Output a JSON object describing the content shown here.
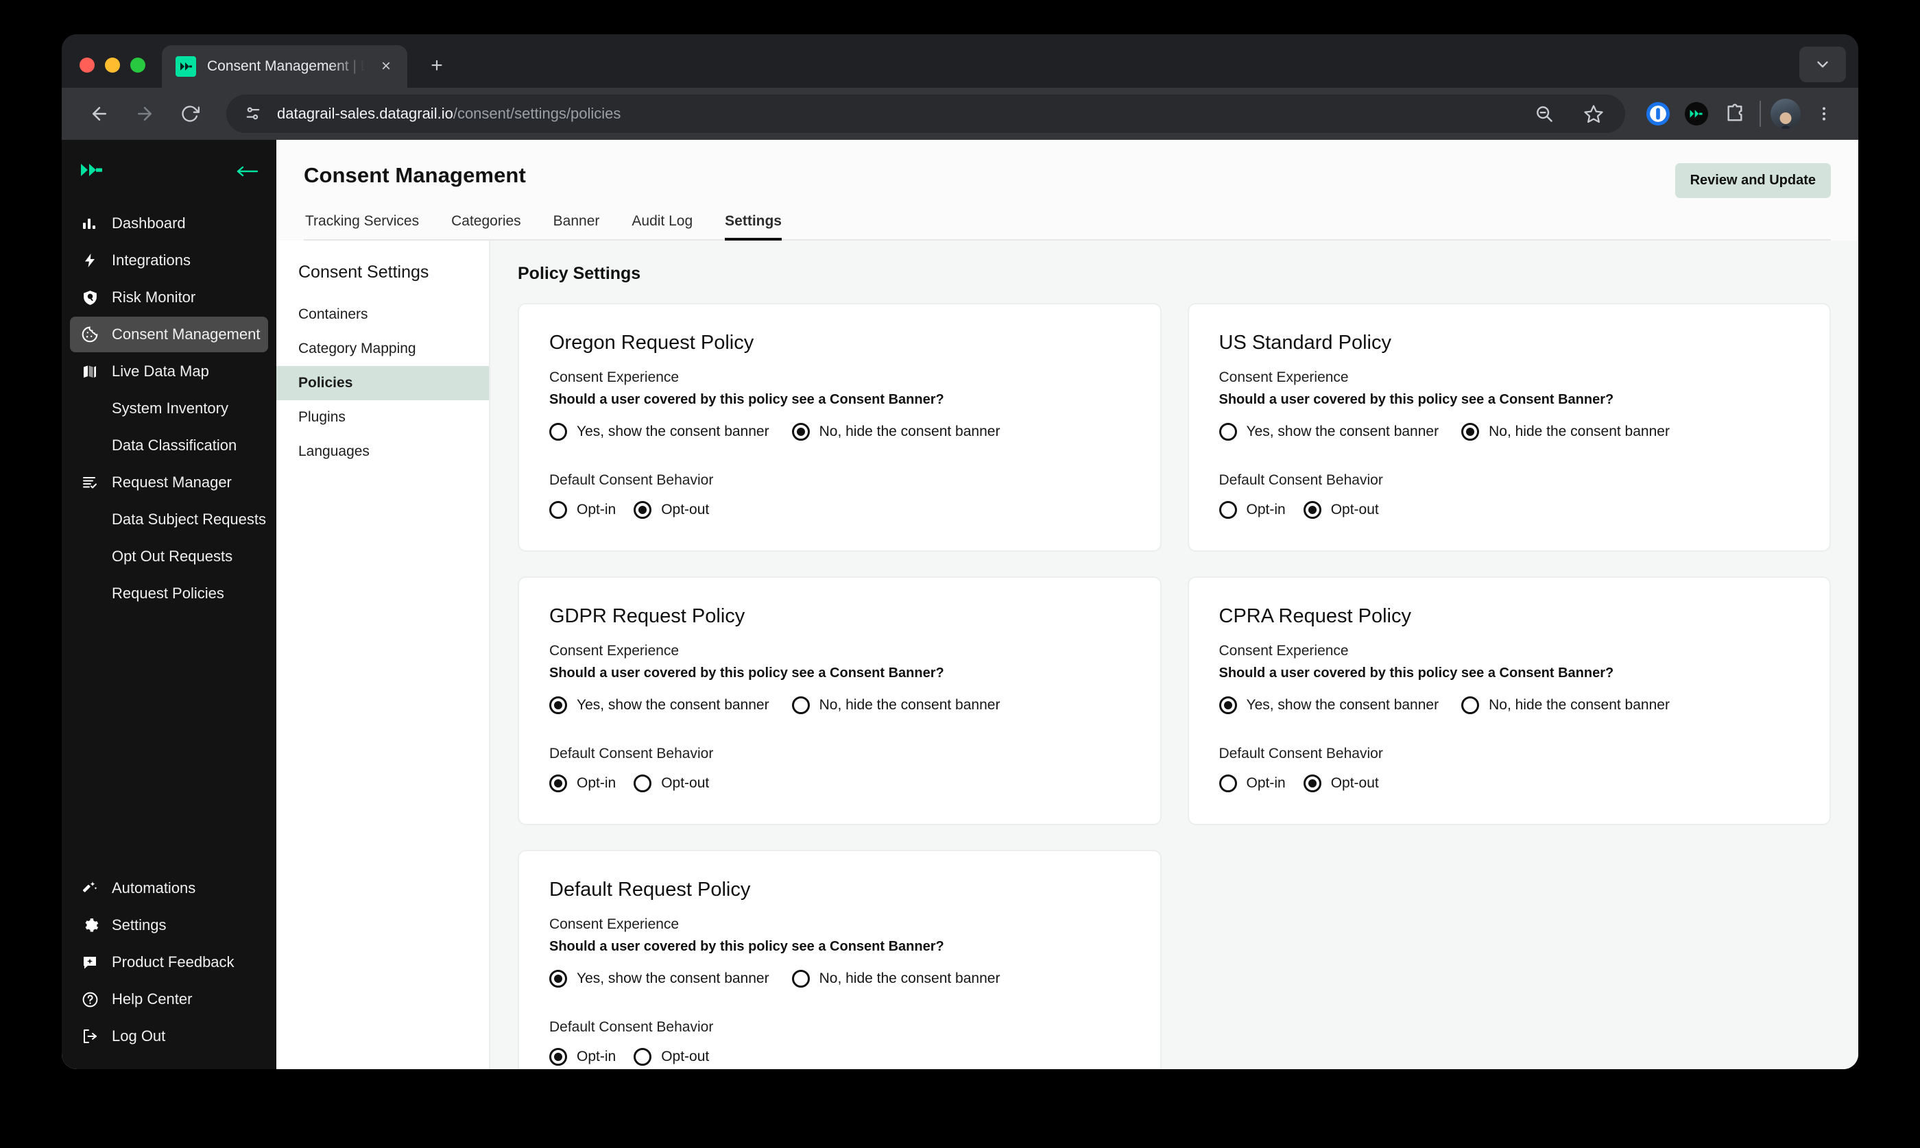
{
  "browser": {
    "tab": {
      "title": "Consent Management | DataG",
      "favicon": "datagrail-logo-icon",
      "close": "×"
    },
    "new_tab": "+",
    "url_domain": "datagrail-sales.datagrail.io",
    "url_path": "/consent/settings/policies",
    "toolbar_icons": [
      "back-arrow-icon",
      "forward-arrow-icon",
      "reload-icon",
      "site-settings-icon",
      "zoom-out-icon",
      "bookmark-star-icon",
      "onepassword-icon",
      "datagrail-extension-icon",
      "extensions-puzzle-icon",
      "profile-avatar",
      "browser-menu-icon"
    ]
  },
  "sidebar": {
    "logo": "datagrail-logo",
    "collapse_icon": "collapse-arrow-icon",
    "items": [
      {
        "label": "Dashboard",
        "icon": "bar-chart-icon",
        "sub": false,
        "active": false
      },
      {
        "label": "Integrations",
        "icon": "lightning-bolt-icon",
        "sub": false,
        "active": false
      },
      {
        "label": "Risk Monitor",
        "icon": "shield-search-icon",
        "sub": false,
        "active": false
      },
      {
        "label": "Consent Management",
        "icon": "cookie-icon",
        "sub": false,
        "active": true
      },
      {
        "label": "Live Data Map",
        "icon": "map-icon",
        "sub": false,
        "active": false
      },
      {
        "label": "System Inventory",
        "icon": "",
        "sub": true,
        "active": false
      },
      {
        "label": "Data Classification",
        "icon": "",
        "sub": true,
        "active": false
      },
      {
        "label": "Request Manager",
        "icon": "task-list-icon",
        "sub": false,
        "active": false
      },
      {
        "label": "Data Subject Requests",
        "icon": "",
        "sub": true,
        "active": false
      },
      {
        "label": "Opt Out Requests",
        "icon": "",
        "sub": true,
        "active": false
      },
      {
        "label": "Request Policies",
        "icon": "",
        "sub": true,
        "active": false
      }
    ],
    "bottom_items": [
      {
        "label": "Automations",
        "icon": "magic-wand-icon"
      },
      {
        "label": "Settings",
        "icon": "gear-icon"
      },
      {
        "label": "Product Feedback",
        "icon": "feedback-chat-icon"
      },
      {
        "label": "Help Center",
        "icon": "question-circle-icon"
      },
      {
        "label": "Log Out",
        "icon": "logout-icon"
      }
    ]
  },
  "header": {
    "title": "Consent Management",
    "review_button": "Review and Update",
    "tabs": [
      {
        "label": "Tracking Services",
        "active": false
      },
      {
        "label": "Categories",
        "active": false
      },
      {
        "label": "Banner",
        "active": false
      },
      {
        "label": "Audit Log",
        "active": false
      },
      {
        "label": "Settings",
        "active": true
      }
    ]
  },
  "subnav": {
    "title": "Consent Settings",
    "items": [
      {
        "label": "Containers",
        "active": false
      },
      {
        "label": "Category Mapping",
        "active": false
      },
      {
        "label": "Policies",
        "active": true
      },
      {
        "label": "Plugins",
        "active": false
      },
      {
        "label": "Languages",
        "active": false
      }
    ]
  },
  "main": {
    "heading": "Policy Settings",
    "labels": {
      "consent_experience": "Consent Experience",
      "banner_question": "Should a user covered by this policy see a Consent Banner?",
      "banner_yes": "Yes, show the consent banner",
      "banner_no": "No, hide the consent banner",
      "default_behavior": "Default Consent Behavior",
      "opt_in": "Opt-in",
      "opt_out": "Opt-out"
    },
    "policies": [
      {
        "name": "Oregon Request Policy",
        "banner": "no",
        "behavior": "opt-out"
      },
      {
        "name": "US Standard Policy",
        "banner": "no",
        "behavior": "opt-out"
      },
      {
        "name": "GDPR Request Policy",
        "banner": "yes",
        "behavior": "opt-in"
      },
      {
        "name": "CPRA Request Policy",
        "banner": "yes",
        "behavior": "opt-out"
      },
      {
        "name": "Default Request Policy",
        "banner": "yes",
        "behavior": "opt-in"
      }
    ]
  },
  "colors": {
    "brand_green": "#00e2a0",
    "accent_mint": "#d3e3dc",
    "sidebar_bg": "#131313",
    "page_bg": "#f5f7f6"
  }
}
